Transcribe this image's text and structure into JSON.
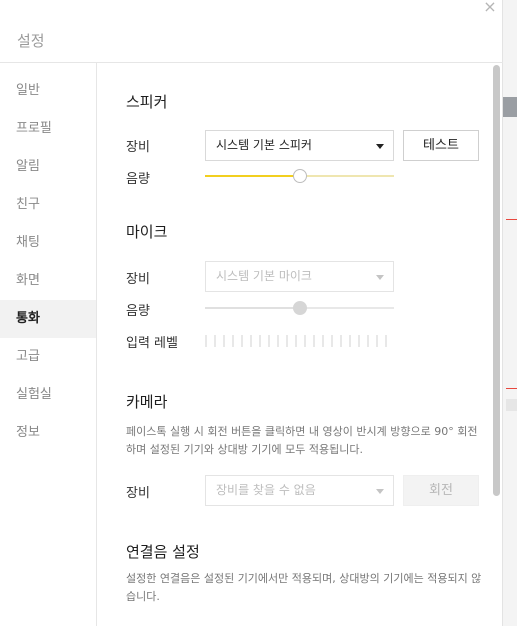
{
  "window": {
    "title": "설정",
    "close_label": "×"
  },
  "sidebar": {
    "items": [
      {
        "label": "일반"
      },
      {
        "label": "프로필"
      },
      {
        "label": "알림"
      },
      {
        "label": "친구"
      },
      {
        "label": "채팅"
      },
      {
        "label": "화면"
      },
      {
        "label": "통화",
        "active": true
      },
      {
        "label": "고급"
      },
      {
        "label": "실험실"
      },
      {
        "label": "정보"
      }
    ]
  },
  "speaker": {
    "title": "스피커",
    "device_label": "장비",
    "device_value": "시스템 기본 스피커",
    "test_button": "테스트",
    "volume_label": "음량",
    "volume_level": 0.5
  },
  "mic": {
    "title": "마이크",
    "device_label": "장비",
    "device_value": "시스템 기본 마이크",
    "volume_label": "음량",
    "volume_level": 0.5,
    "input_level_label": "입력 레벨"
  },
  "camera": {
    "title": "카메라",
    "description": "페이스톡 실행 시 회전 버튼을 클릭하면 내 영상이 반시계 방향으로 90° 회전하며 설정된 기기와 상대방 기기에 모두 적용됩니다.",
    "device_label": "장비",
    "device_placeholder": "장비를 찾을 수 없음",
    "rotate_button": "회전"
  },
  "ringtone": {
    "title": "연결음 설정",
    "description": "설정한 연결음은 설정된 기기에서만 적용되며, 상대방의 기기에는 적용되지 않습니다."
  },
  "colors": {
    "accent": "#f2cf1f",
    "accent_track": "#efe6b0"
  }
}
